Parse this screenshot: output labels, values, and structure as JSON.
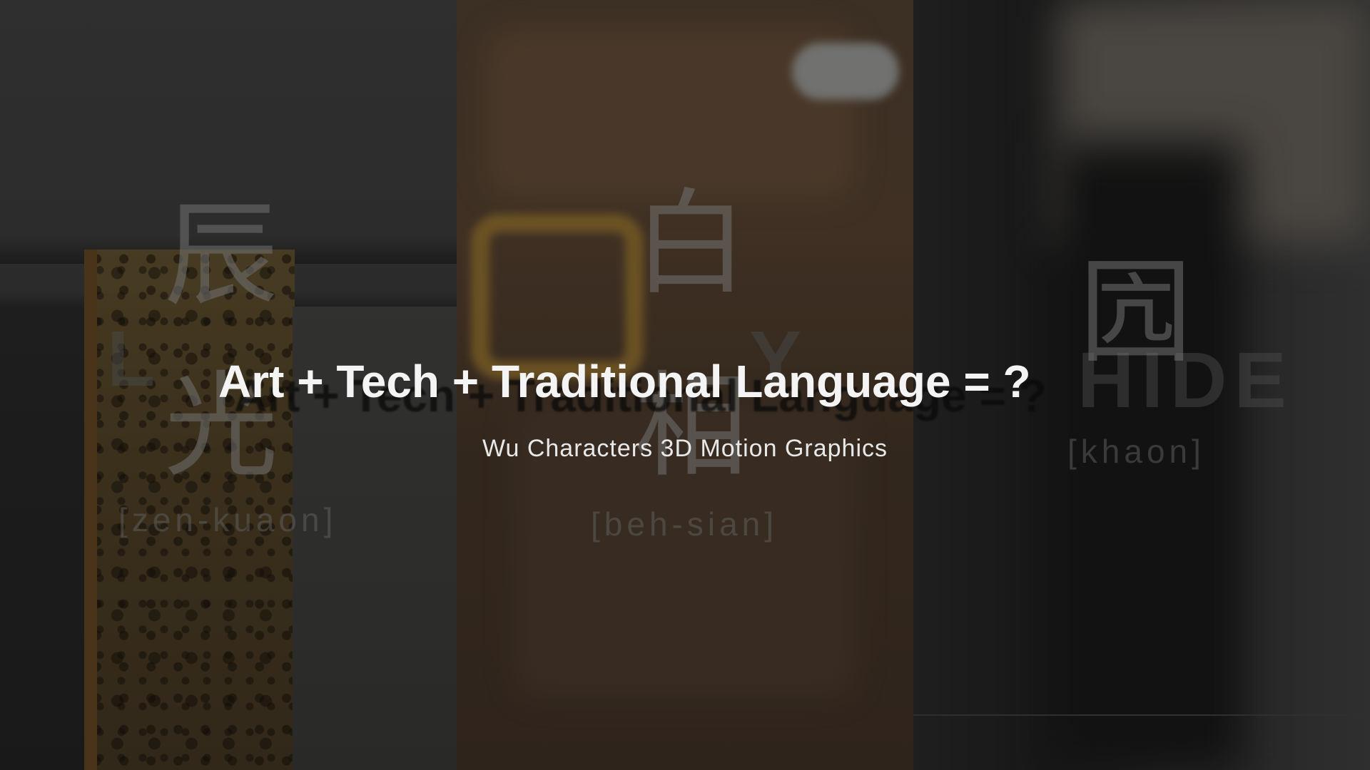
{
  "title": "Art + Tech + Traditional Language = ?",
  "subtitle": "Wu Characters 3D Motion Graphics",
  "panels": [
    {
      "characters": [
        "辰",
        "光"
      ],
      "romanization": "[zen-kuaon]",
      "ghost_word": "L"
    },
    {
      "characters": [
        "白",
        "相"
      ],
      "romanization": "[beh-sian]",
      "ghost_word": "Y"
    },
    {
      "characters": [
        "囥"
      ],
      "romanization": "[khaon]",
      "ghost_word": "HIDE"
    }
  ],
  "colors": {
    "title": "#f4f4f4",
    "subtitle": "#e8e8e8",
    "panel_wall": "#3a3a3a",
    "panel_wood": "#4a3a2c",
    "panel_dark": "#1d1d1d",
    "scroll_ochre": "#5a4a2b"
  }
}
